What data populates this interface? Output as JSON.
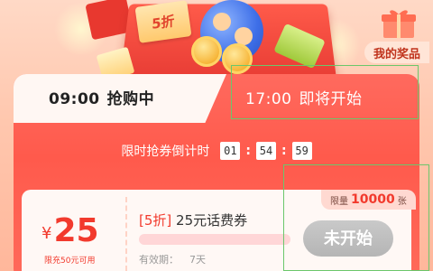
{
  "hero": {
    "coupon_text": "5折",
    "my_prizes": "我的奖品"
  },
  "tabs": [
    {
      "time": "09:00",
      "status": "抢购中"
    },
    {
      "time": "17:00",
      "status": "即将开始"
    }
  ],
  "countdown": {
    "label": "限时抢券倒计时",
    "hours": "01",
    "minutes": "54",
    "seconds": "59"
  },
  "coupon": {
    "currency": "¥",
    "amount": "25",
    "limit": "限充50元可用",
    "tag": "[5折]",
    "title": "25元话费券",
    "validity_label": "有效期：",
    "validity_days": "7天",
    "quota_prefix": "限量",
    "quota_num": "10000",
    "quota_unit": "张",
    "button": "未开始"
  },
  "colors": {
    "accent": "#f23a2d",
    "card": "#ff5a4c",
    "disabled": "#c2c2c2"
  }
}
